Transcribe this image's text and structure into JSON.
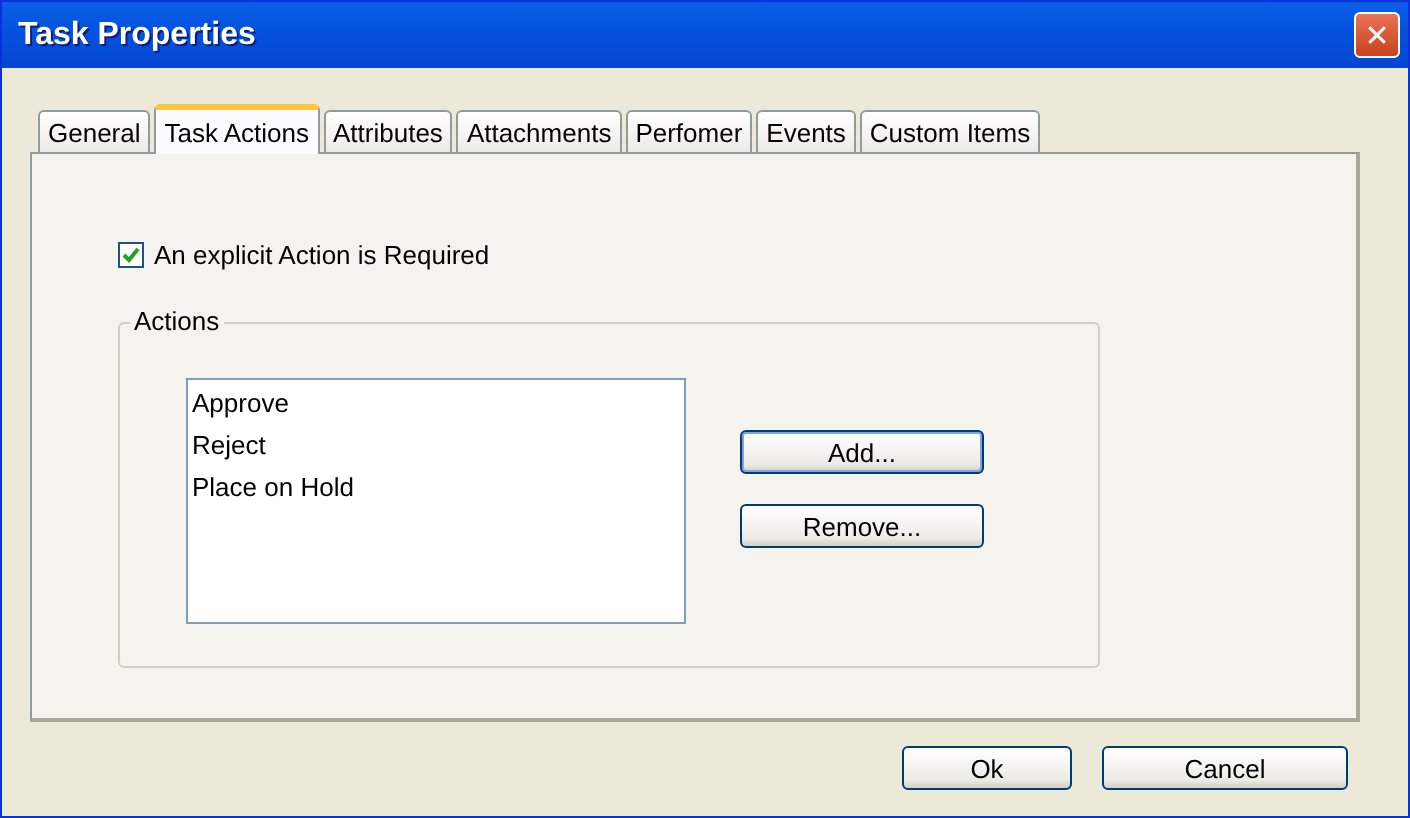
{
  "window": {
    "title": "Task Properties",
    "close": "✕"
  },
  "tabs": [
    {
      "label": "General",
      "selected": false
    },
    {
      "label": "Task Actions",
      "selected": true
    },
    {
      "label": "Attributes",
      "selected": false
    },
    {
      "label": "Attachments",
      "selected": false
    },
    {
      "label": "Perfomer",
      "selected": false
    },
    {
      "label": "Events",
      "selected": false
    },
    {
      "label": "Custom Items",
      "selected": false
    }
  ],
  "checkbox": {
    "label": "An explicit Action is Required",
    "checked": true
  },
  "actions": {
    "title": "Actions",
    "items": [
      "Approve",
      "Reject",
      "Place on Hold"
    ],
    "buttons": [
      "Add...",
      "Remove..."
    ]
  },
  "buttons": [
    "Ok",
    "Cancel"
  ]
}
